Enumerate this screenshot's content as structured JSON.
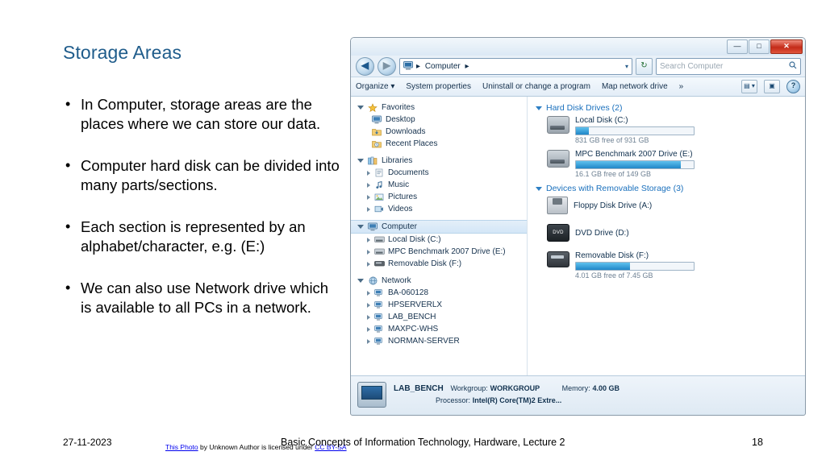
{
  "slide": {
    "title": "Storage Areas",
    "bullets": [
      "In Computer, storage areas are the places where we can store our data.",
      "Computer hard disk can be divided into many parts/sections.",
      "Each section is represented by an alphabet/character, e.g. (E:)",
      "We can also use Network drive which is available to all PCs in a network."
    ]
  },
  "footer": {
    "date": "27-11-2023",
    "center": "Basic Concepts of Information Technology, Hardware, Lecture 2",
    "page": "18",
    "attribution": {
      "link1": "This Photo",
      "mid": " by Unknown Author is licensed under ",
      "link2": "CC BY-SA"
    }
  },
  "explorer": {
    "window_buttons": {
      "minimize": "—",
      "maximize": "□",
      "close": "✕"
    },
    "address": {
      "prefix": "Computer",
      "separator": "▸",
      "chevron": "▾",
      "refresh_icon": "↻"
    },
    "search": {
      "placeholder": "Search Computer",
      "icon": "search-icon"
    },
    "toolbar": {
      "organize": "Organize ▾",
      "system_properties": "System properties",
      "uninstall": "Uninstall or change a program",
      "map_network": "Map network drive",
      "overflow": "»",
      "view_icon": "▤ ▾",
      "preview_icon": "▣",
      "help_icon": "?"
    },
    "nav_pane": {
      "groups": [
        {
          "name": "Favorites",
          "icon": "star-icon",
          "items": [
            {
              "label": "Desktop",
              "icon": "desktop-icon"
            },
            {
              "label": "Downloads",
              "icon": "downloads-icon"
            },
            {
              "label": "Recent Places",
              "icon": "recent-places-icon"
            }
          ]
        },
        {
          "name": "Libraries",
          "icon": "libraries-icon",
          "items": [
            {
              "label": "Documents",
              "icon": "documents-icon"
            },
            {
              "label": "Music",
              "icon": "music-icon"
            },
            {
              "label": "Pictures",
              "icon": "pictures-icon"
            },
            {
              "label": "Videos",
              "icon": "videos-icon"
            }
          ]
        },
        {
          "name": "Computer",
          "icon": "computer-icon",
          "selected": true,
          "items": [
            {
              "label": "Local Disk (C:)",
              "icon": "hard-drive-icon"
            },
            {
              "label": "MPC Benchmark 2007 Drive (E:)",
              "icon": "hard-drive-icon"
            },
            {
              "label": "Removable Disk (F:)",
              "icon": "removable-disk-icon"
            }
          ]
        },
        {
          "name": "Network",
          "icon": "network-icon",
          "items": [
            {
              "label": "BA-060128",
              "icon": "computer-node-icon"
            },
            {
              "label": "HPSERVERLX",
              "icon": "computer-node-icon"
            },
            {
              "label": "LAB_BENCH",
              "icon": "computer-node-icon"
            },
            {
              "label": "MAXPC-WHS",
              "icon": "computer-node-icon"
            },
            {
              "label": "NORMAN-SERVER",
              "icon": "computer-node-icon"
            }
          ]
        }
      ]
    },
    "content": {
      "groups": [
        {
          "heading": "Hard Disk Drives (2)",
          "items": [
            {
              "name": "Local Disk (C:)",
              "free": "831 GB free of 931 GB",
              "fill_percent": 11,
              "fill_color": "#2f9ad8",
              "icon": "hard-drive-icon"
            },
            {
              "name": "MPC Benchmark 2007 Drive (E:)",
              "free": "16.1 GB free of 149 GB",
              "fill_percent": 89,
              "fill_color": "#2f9ad8",
              "icon": "hard-drive-icon"
            }
          ]
        },
        {
          "heading": "Devices with Removable Storage (3)",
          "items": [
            {
              "name": "Floppy Disk Drive (A:)",
              "free": "",
              "fill_percent": 0,
              "icon": "floppy-disk-icon"
            },
            {
              "name": "DVD Drive (D:)",
              "free": "",
              "fill_percent": 0,
              "icon": "dvd-drive-icon"
            },
            {
              "name": "Removable Disk (F:)",
              "free": "4.01 GB free of 7.45 GB",
              "fill_percent": 46,
              "fill_color": "#2f9ad8",
              "icon": "removable-disk-icon"
            }
          ]
        }
      ]
    },
    "details": {
      "computer_name": "LAB_BENCH",
      "workgroup_label": "Workgroup:",
      "workgroup_value": "WORKGROUP",
      "memory_label": "Memory:",
      "memory_value": "4.00 GB",
      "processor_label": "Processor:",
      "processor_value": "Intel(R) Core(TM)2 Extre..."
    }
  }
}
